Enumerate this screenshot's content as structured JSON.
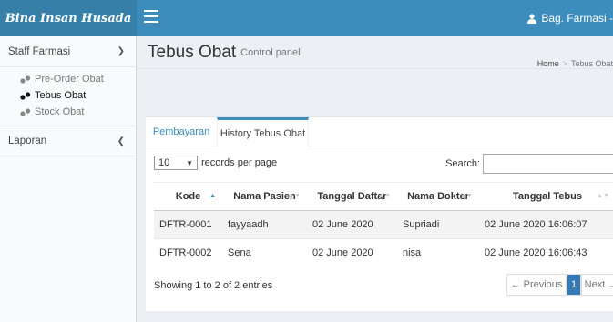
{
  "brand": {
    "logo_text": "Bina Insan Husada"
  },
  "topbar": {
    "user_label": "Bag. Farmasi -"
  },
  "sidebar": {
    "section1": {
      "label": "Staff Farmasi"
    },
    "items": [
      {
        "label": "Pre-Order Obat"
      },
      {
        "label": "Tebus Obat"
      },
      {
        "label": "Stock Obat"
      }
    ],
    "section2": {
      "label": "Laporan"
    }
  },
  "header": {
    "title": "Tebus Obat",
    "subtitle": "Control panel"
  },
  "breadcrumb": {
    "home": "Home",
    "separator": ">",
    "current": "Tebus Obat"
  },
  "tabs": [
    {
      "label": "Pembayaran"
    },
    {
      "label": "History Tebus Obat"
    }
  ],
  "table_controls": {
    "length_value": "10",
    "length_suffix": "records per page",
    "search_label": "Search:"
  },
  "table": {
    "columns": [
      "Kode",
      "Nama Pasien",
      "Tanggal Daftar",
      "Nama Dokter",
      "Tanggal Tebus"
    ],
    "rows": [
      [
        "DFTR-0001",
        "fayyaadh",
        "02 June 2020",
        "Supriadi",
        "02 June 2020 16:06:07"
      ],
      [
        "DFTR-0002",
        "Sena",
        "02 June 2020",
        "nisa",
        "02 June 2020 16:06:43"
      ]
    ]
  },
  "footer": {
    "info": "Showing 1 to 2 of 2 entries",
    "prev": "← Previous",
    "page": "1",
    "next": "Next →"
  },
  "colors": {
    "topbar": "#3c8dbc",
    "logo_bg": "#367fa9",
    "accent": "#3c8dbc",
    "pagination_active": "#337ab7"
  }
}
